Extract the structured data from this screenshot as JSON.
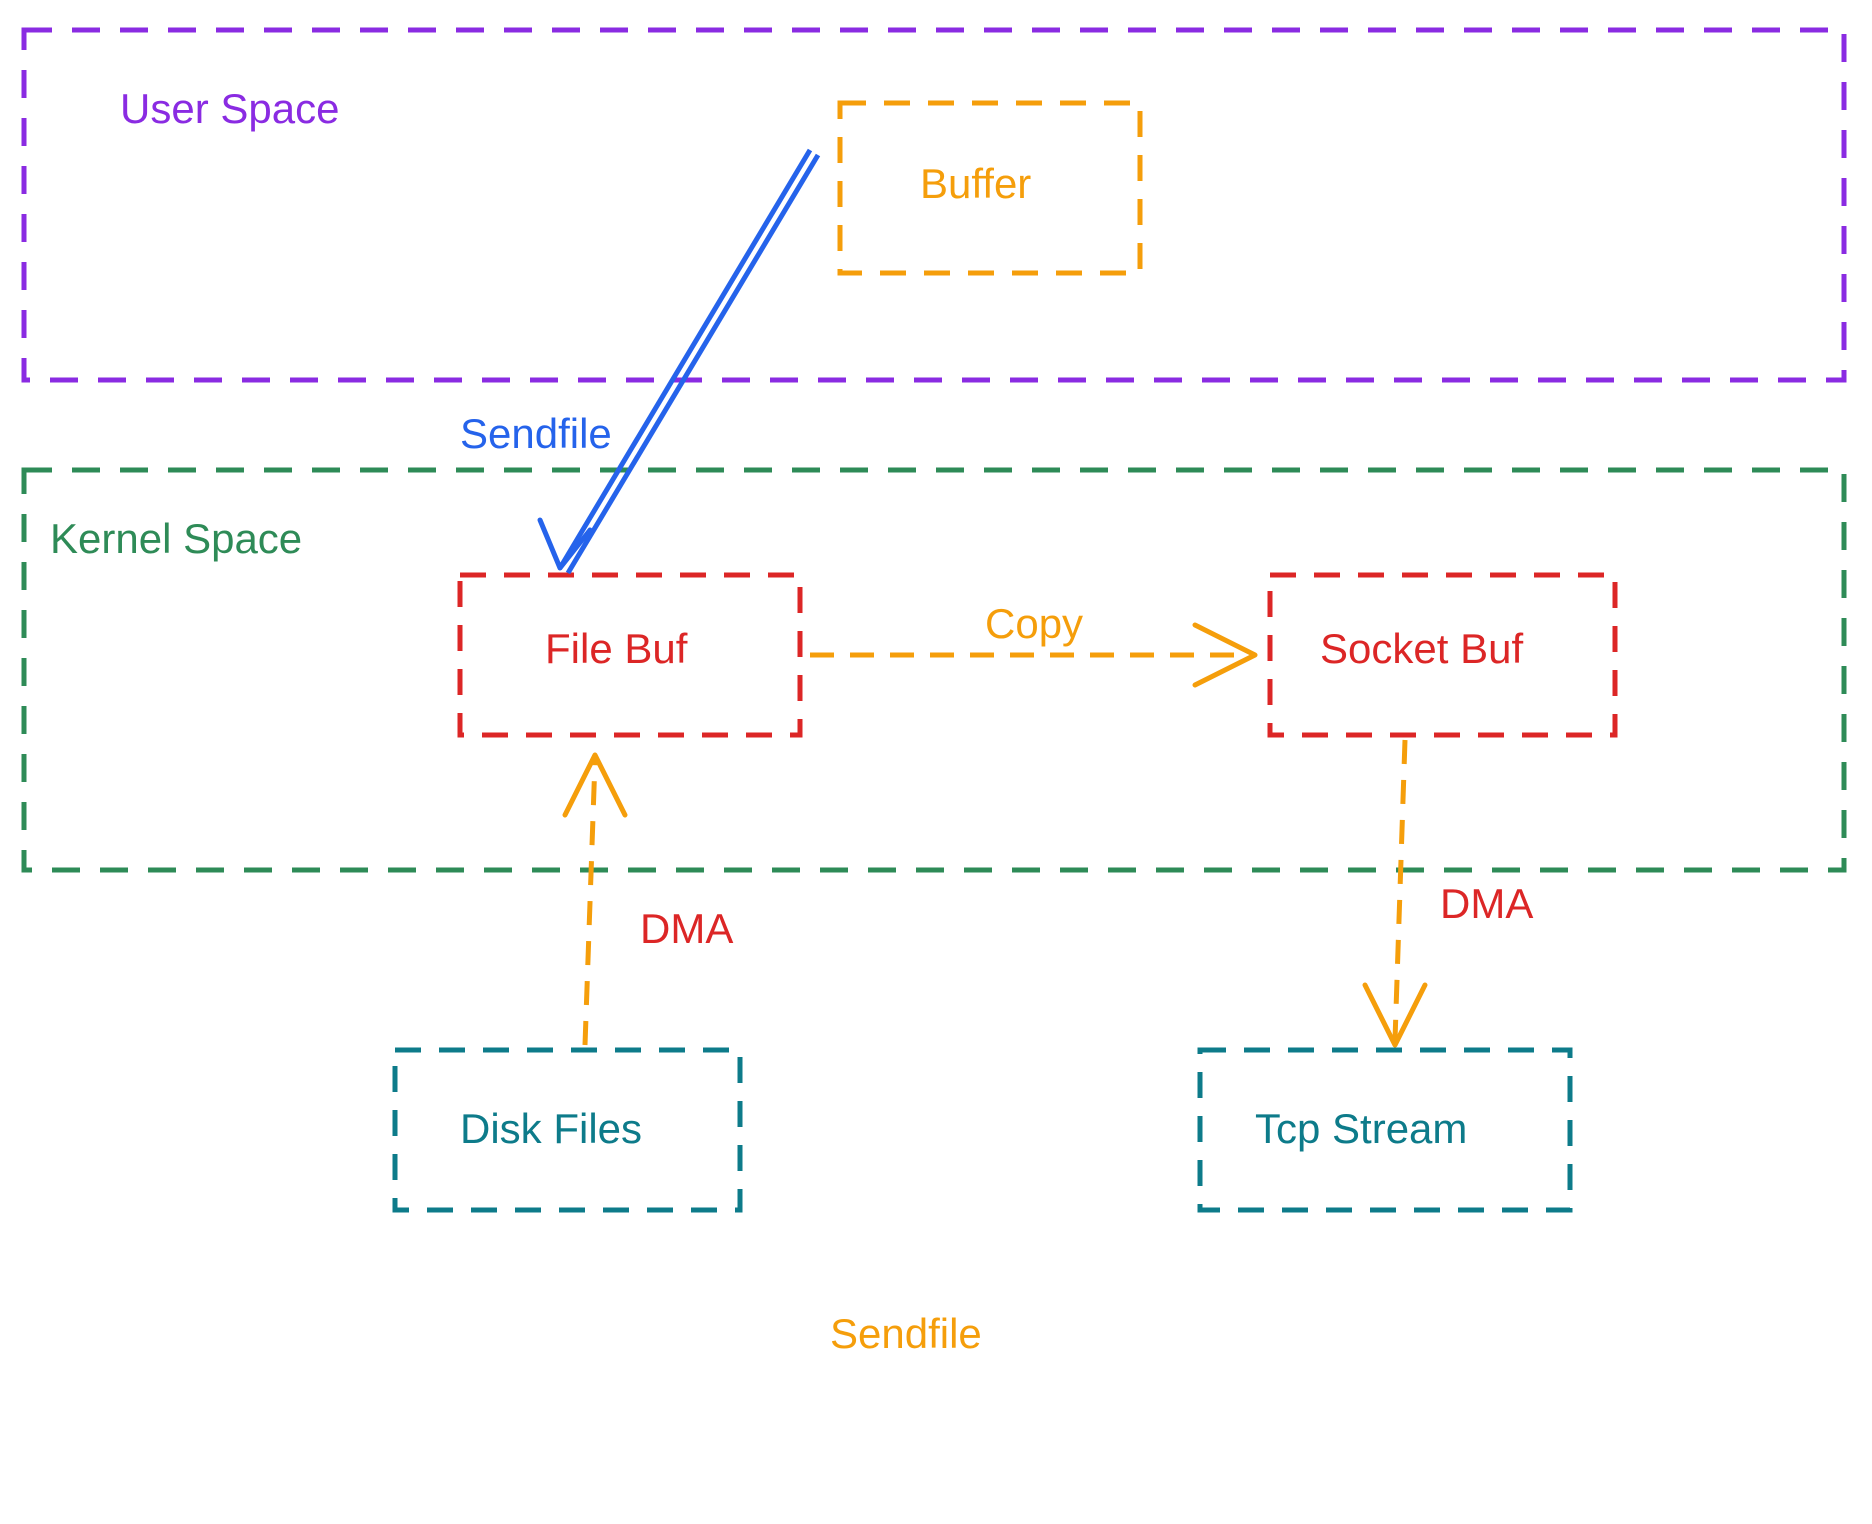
{
  "diagram": {
    "title": "Sendfile",
    "userSpace": {
      "label": "User Space",
      "color": "#8a2be2"
    },
    "kernelSpace": {
      "label": "Kernel Space",
      "color": "#2e8b57"
    },
    "boxes": {
      "buffer": {
        "label": "Buffer",
        "color": "#f59e0b"
      },
      "fileBuf": {
        "label": "File Buf",
        "color": "#dc2626"
      },
      "socketBuf": {
        "label": "Socket Buf",
        "color": "#dc2626"
      },
      "diskFiles": {
        "label": "Disk Files",
        "color": "#0d7b8a"
      },
      "tcpStream": {
        "label": "Tcp Stream",
        "color": "#0d7b8a"
      }
    },
    "arrows": {
      "sendfile": {
        "label": "Sendfile",
        "color": "#2563eb"
      },
      "copy": {
        "label": "Copy",
        "color": "#f59e0b"
      },
      "dma1": {
        "label": "DMA",
        "color": "#dc2626"
      },
      "dma2": {
        "label": "DMA",
        "color": "#dc2626"
      }
    },
    "colors": {
      "purple": "#8a2be2",
      "green": "#2e8b57",
      "teal": "#0d7b8a",
      "orange": "#f59e0b",
      "red": "#dc2626",
      "blue": "#2563eb"
    }
  }
}
